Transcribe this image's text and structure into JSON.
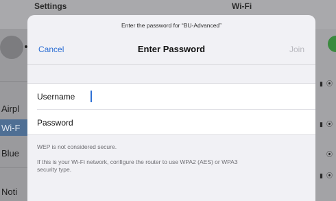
{
  "background": {
    "left_title": "Settings",
    "right_title": "Wi-Fi",
    "sidebar_rows": [
      "Airpl",
      "Wi-F",
      "Blue",
      "Noti"
    ],
    "selected_row": "Wi-F"
  },
  "modal": {
    "prompt": "Enter the password for “BU-Advanced”",
    "cancel_label": "Cancel",
    "title": "Enter Password",
    "join_label": "Join",
    "username_label": "Username",
    "username_value": "",
    "password_label": "Password",
    "password_value": "",
    "note_wep": "WEP is not considered secure.",
    "note_config": "If this is your Wi-Fi network, configure the router to use WPA2 (AES) or WPA3 security type."
  },
  "colors": {
    "accent": "#2d6fd4",
    "disabled": "#b9b9bf",
    "selected_row": "#4f6f94",
    "toggle_on": "#3a8a3e"
  }
}
